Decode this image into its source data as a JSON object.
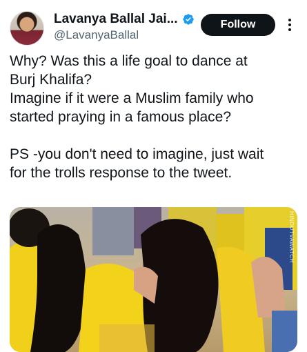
{
  "author": {
    "display_name": "Lavanya Ballal Jai...",
    "handle": "@LavanyaBallal",
    "verified": true
  },
  "follow_button": {
    "label": "Follow"
  },
  "tweet": {
    "paragraph1_line1": "Why? Was this a life goal to dance at",
    "paragraph1_line2": "Burj Khalifa?",
    "paragraph1_line3": "Imagine if it were a Muslim family who",
    "paragraph1_line4": "started praying in a famous place?",
    "paragraph2_line1": "PS -you don't need to imagine, just wait",
    "paragraph2_line2": "for the trolls response to the tweet."
  },
  "media": {
    "watermark": "HINDUTVAWATCH"
  },
  "colors": {
    "follow_bg": "#0f1419",
    "verified": "#1d9bf0",
    "secondary_text": "#536471"
  }
}
